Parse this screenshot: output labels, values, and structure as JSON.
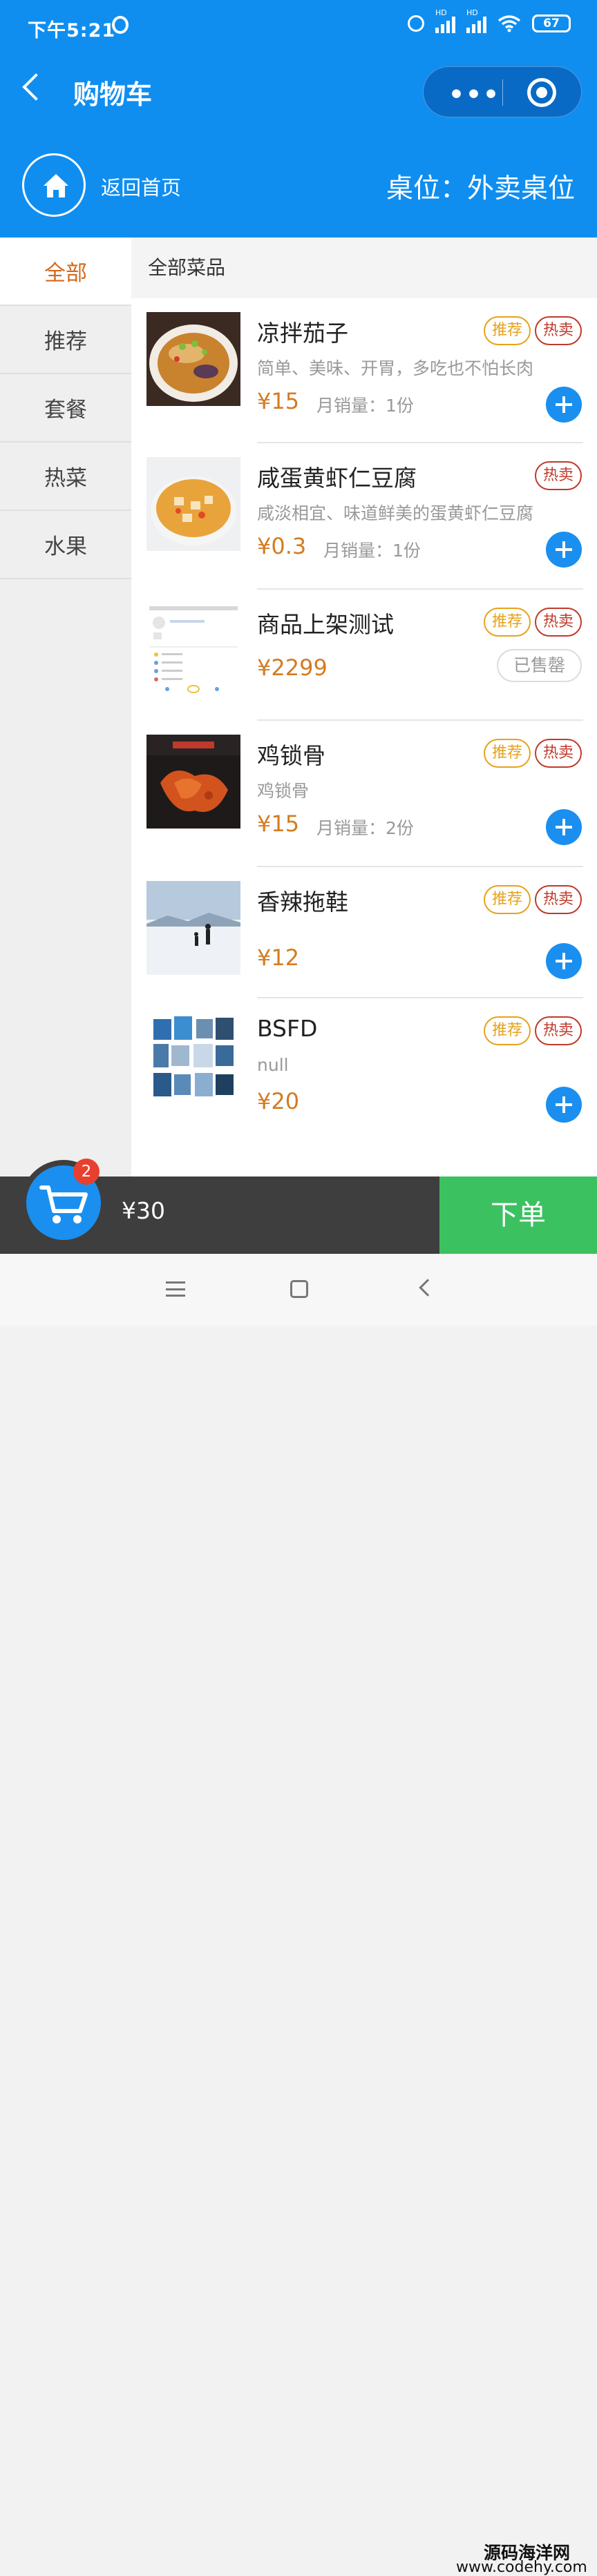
{
  "status_bar": {
    "time": "下午5:21",
    "battery": "67",
    "hd1": "HD",
    "hd2": "HD"
  },
  "nav": {
    "title": "购物车",
    "capsule_more": "•••"
  },
  "header": {
    "home_label": "返回首页",
    "table_label": "桌位：外卖桌位"
  },
  "sidebar": {
    "items": [
      {
        "label": "全部"
      },
      {
        "label": "推荐"
      },
      {
        "label": "套餐"
      },
      {
        "label": "热菜"
      },
      {
        "label": "水果"
      }
    ]
  },
  "content": {
    "category_title": "全部菜品",
    "tag_recommend": "推荐",
    "tag_hot": "热卖",
    "products": [
      {
        "name": "凉拌茄子",
        "desc": "简单、美味、开胃，多吃也不怕长肉",
        "price": "¥15",
        "sales": "月销量：1份"
      },
      {
        "name": "咸蛋黄虾仁豆腐",
        "desc": "咸淡相宜、味道鲜美的蛋黄虾仁豆腐",
        "price": "¥0.3",
        "sales": "月销量：1份"
      },
      {
        "name": "商品上架测试",
        "desc": "",
        "price": "¥2299",
        "status": "已售罄"
      },
      {
        "name": "鸡锁骨",
        "desc": "鸡锁骨",
        "price": "¥15",
        "sales": "月销量：2份"
      },
      {
        "name": "香辣拖鞋",
        "desc": "",
        "price": "¥12"
      },
      {
        "name": "BSFD",
        "desc": "null",
        "price": "¥20"
      }
    ]
  },
  "cart": {
    "badge": "2",
    "total": "¥30",
    "order_label": "下单"
  },
  "watermark": {
    "line1": "源码海洋网",
    "line2": "www.codehy.com"
  },
  "colors": {
    "brand_blue": "#0f8ef0",
    "price_orange": "#d47b21",
    "order_green": "#3cc161"
  }
}
